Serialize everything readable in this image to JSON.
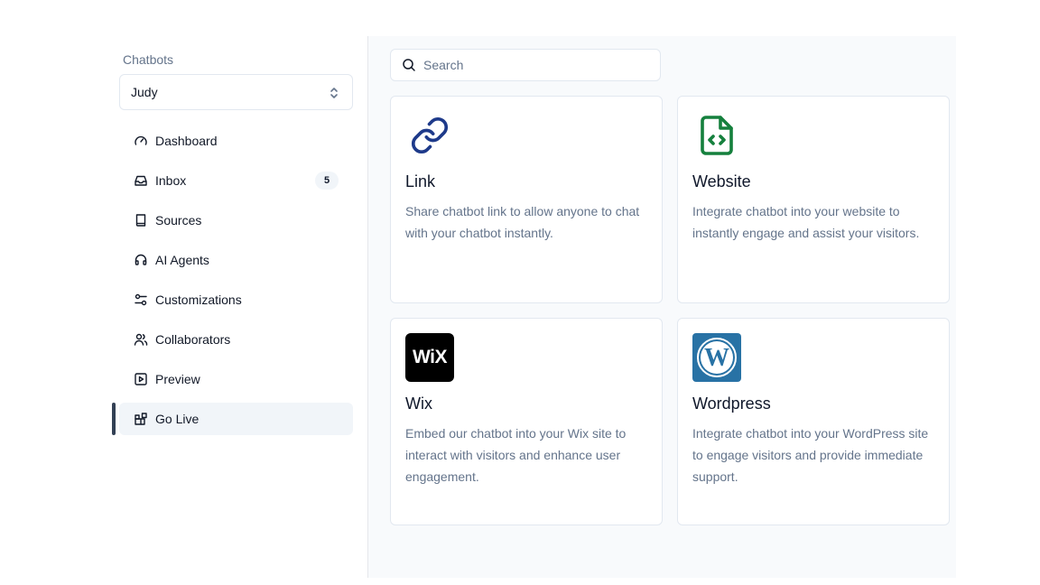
{
  "sidebar": {
    "label": "Chatbots",
    "selected_bot": "Judy",
    "items": [
      {
        "label": "Dashboard",
        "icon": "gauge-icon"
      },
      {
        "label": "Inbox",
        "icon": "inbox-icon",
        "badge": "5"
      },
      {
        "label": "Sources",
        "icon": "book-icon"
      },
      {
        "label": "AI Agents",
        "icon": "headphones-icon"
      },
      {
        "label": "Customizations",
        "icon": "sliders-icon"
      },
      {
        "label": "Collaborators",
        "icon": "users-icon"
      },
      {
        "label": "Preview",
        "icon": "play-square-icon"
      },
      {
        "label": "Go Live",
        "icon": "blocks-icon",
        "active": true
      }
    ]
  },
  "search": {
    "placeholder": "Search",
    "value": ""
  },
  "integrations": [
    {
      "title": "Link",
      "description": "Share chatbot link to allow anyone to chat with your chatbot instantly.",
      "icon": "link-icon"
    },
    {
      "title": "Website",
      "description": "Integrate chatbot into your website to instantly engage and assist your visitors.",
      "icon": "file-code-icon"
    },
    {
      "title": "Wix",
      "description": "Embed our chatbot into your Wix site to interact with visitors and enhance user engagement.",
      "icon": "wix-logo",
      "logo_text": "WiX"
    },
    {
      "title": "Wordpress",
      "description": "Integrate chatbot into your WordPress site to engage visitors and provide immediate support.",
      "icon": "wordpress-logo"
    }
  ],
  "colors": {
    "accent": "#334155",
    "link_icon": "#1e3a8a",
    "website_icon": "#15803d",
    "wordpress": "#2872a5"
  }
}
